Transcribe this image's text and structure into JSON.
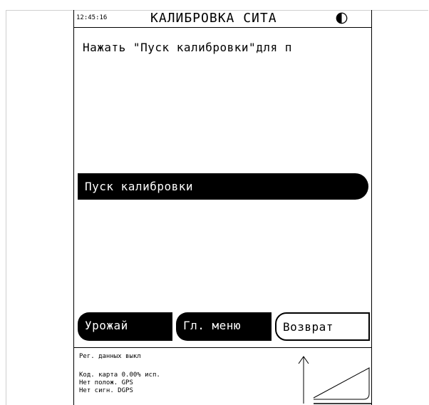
{
  "header": {
    "time": "12:45:16",
    "title": "КАЛИБРОВКА СИТА",
    "contrast_icon": "contrast-icon"
  },
  "main": {
    "instruction": "Нажать \"Пуск калибровки\"для п",
    "start_button": "Пуск калибровки"
  },
  "softkeys": {
    "harvest": "Урожай",
    "main_menu": "Гл. меню",
    "back": "Возврат"
  },
  "status": {
    "recording": "Рег. данных выкл",
    "card": "Код. карта   0.00% исп.",
    "gps": "Нет полож. GPS",
    "dgps": "Нет сигн. DGPS"
  }
}
